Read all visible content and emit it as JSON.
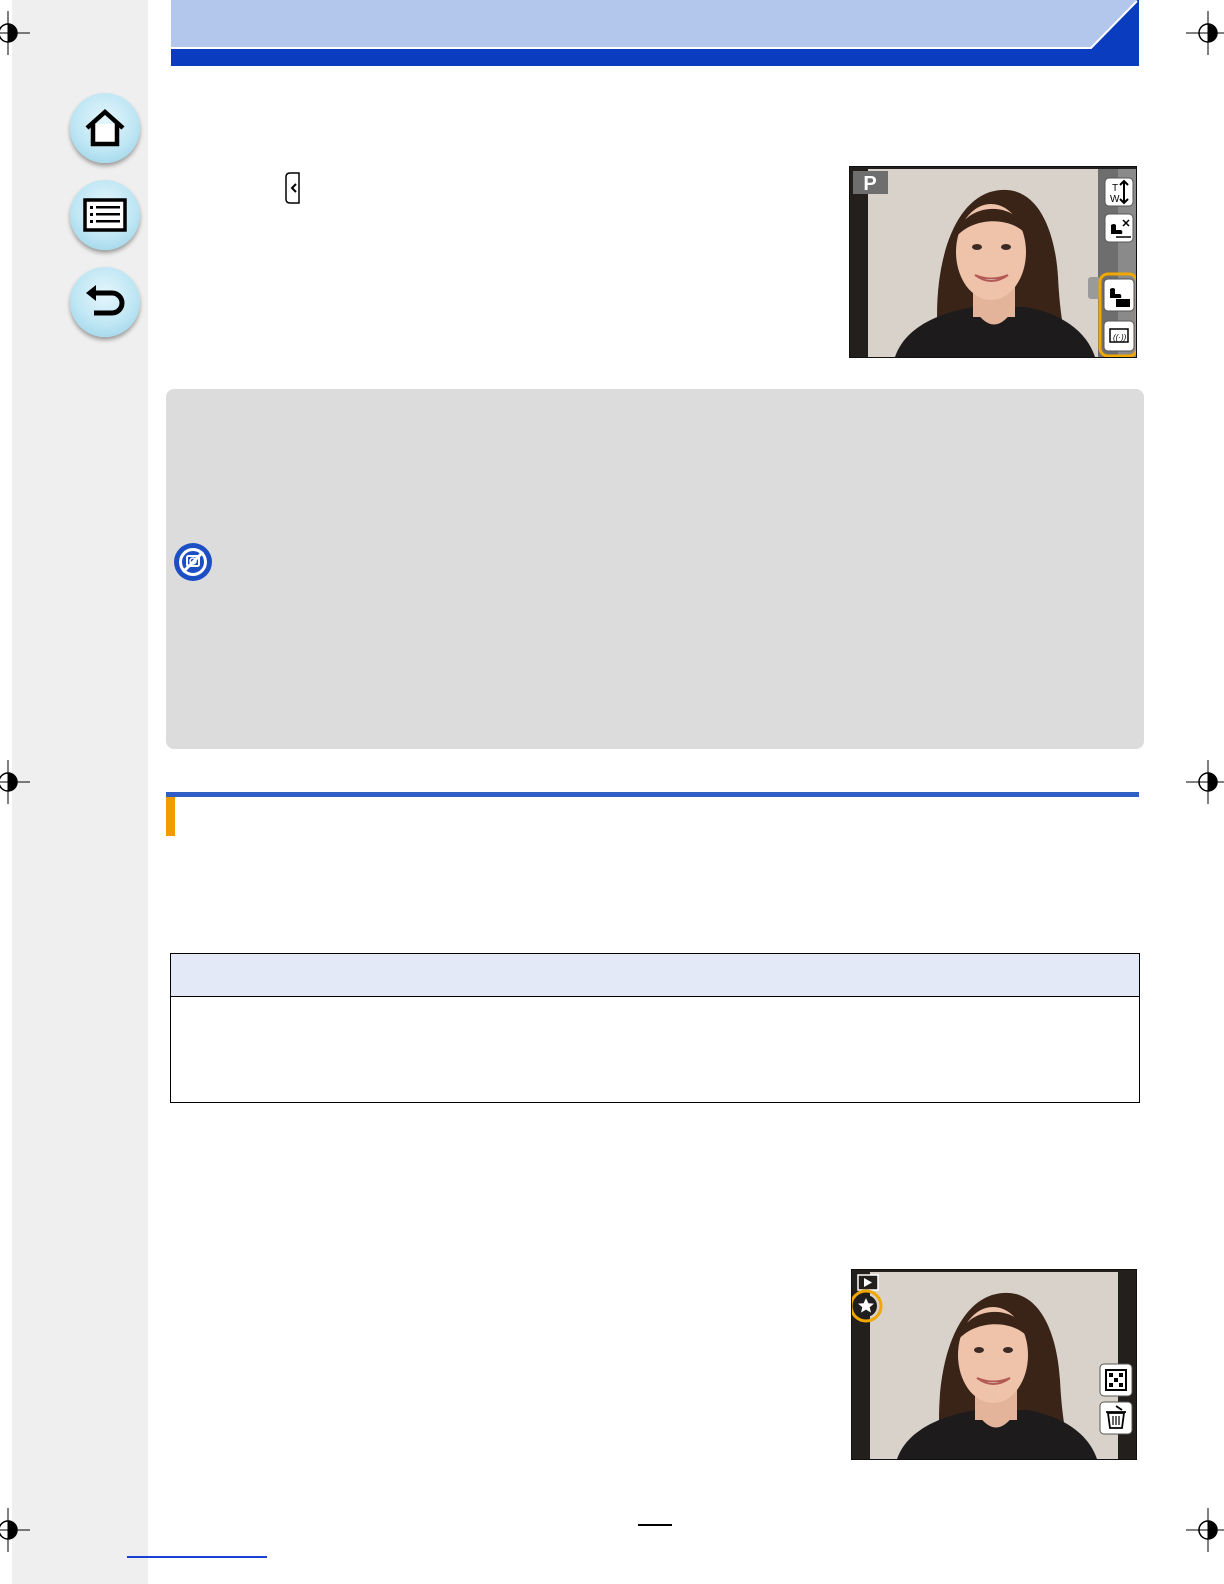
{
  "page": {
    "title": "",
    "page_number": ""
  },
  "nav": {
    "items": [
      {
        "name": "home",
        "icon": "home-icon"
      },
      {
        "name": "contents",
        "icon": "list-icon"
      },
      {
        "name": "back",
        "icon": "return-icon"
      }
    ]
  },
  "screen_top": {
    "mode_label": "P",
    "icons": [
      "zoom-tw-icon",
      "touch-shutter-off-icon",
      "touch-ae-icon",
      "peaking-icon"
    ],
    "highlighted_icons": [
      "touch-ae-icon",
      "peaking-icon"
    ]
  },
  "screen_bottom": {
    "icons": [
      "playback-icon",
      "favorite-star-icon",
      "multi-playback-icon",
      "delete-icon"
    ],
    "highlighted_icons": [
      "favorite-star-icon"
    ]
  },
  "colors": {
    "header_light": "#b3c7ec",
    "header_dark": "#0a3cc0",
    "note_bg": "#dcdcdc",
    "section_rule": "#2f5ec4",
    "section_tab": "#f29a00",
    "table_head": "#e4e9f8",
    "highlight": "#f0a800"
  }
}
